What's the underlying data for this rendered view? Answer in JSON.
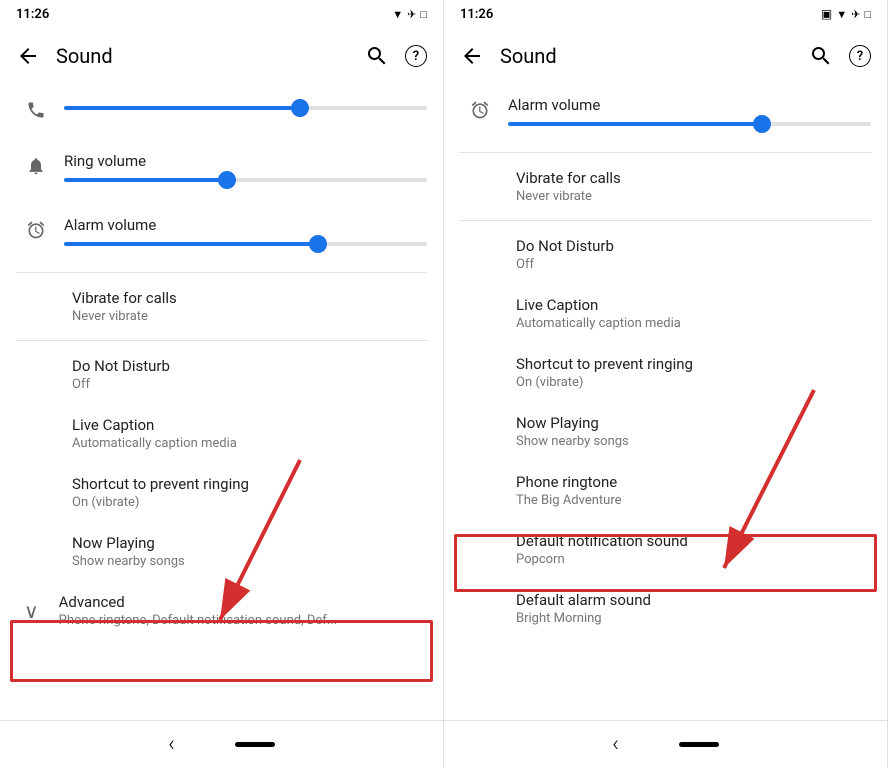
{
  "left_panel": {
    "status": {
      "time": "11:26",
      "icons": "▼ ✈ □"
    },
    "title": "Sound",
    "sliders": [
      {
        "id": "media",
        "fill_pct": 65,
        "thumb_pct": 65
      },
      {
        "id": "ring",
        "label": "Ring volume",
        "fill_pct": 45,
        "thumb_pct": 45
      },
      {
        "id": "alarm",
        "label": "Alarm volume",
        "fill_pct": 70,
        "thumb_pct": 70
      }
    ],
    "settings": [
      {
        "id": "vibrate",
        "title": "Vibrate for calls",
        "subtitle": "Never vibrate"
      },
      {
        "id": "dnd",
        "title": "Do Not Disturb",
        "subtitle": "Off"
      },
      {
        "id": "live_caption",
        "title": "Live Caption",
        "subtitle": "Automatically caption media"
      },
      {
        "id": "prevent_ringing",
        "title": "Shortcut to prevent ringing",
        "subtitle": "On (vibrate)"
      },
      {
        "id": "now_playing",
        "title": "Now Playing",
        "subtitle": "Show nearby songs"
      },
      {
        "id": "advanced",
        "title": "Advanced",
        "subtitle": "Phone ringtone, Default notification sound, Def..."
      }
    ]
  },
  "right_panel": {
    "status": {
      "time": "11:26",
      "icons": "▼ ✈ □"
    },
    "title": "Sound",
    "alarm_volume": {
      "label": "Alarm volume",
      "fill_pct": 70,
      "thumb_pct": 70
    },
    "settings": [
      {
        "id": "vibrate",
        "title": "Vibrate for calls",
        "subtitle": "Never vibrate"
      },
      {
        "id": "dnd",
        "title": "Do Not Disturb",
        "subtitle": "Off"
      },
      {
        "id": "live_caption",
        "title": "Live Caption",
        "subtitle": "Automatically caption media"
      },
      {
        "id": "prevent_ringing",
        "title": "Shortcut to prevent ringing",
        "subtitle": "On (vibrate)"
      },
      {
        "id": "now_playing",
        "title": "Now Playing",
        "subtitle": "Show nearby songs"
      },
      {
        "id": "phone_ringtone",
        "title": "Phone ringtone",
        "subtitle": "The Big Adventure"
      },
      {
        "id": "default_notification",
        "title": "Default notification sound",
        "subtitle": "Popcorn"
      },
      {
        "id": "default_alarm",
        "title": "Default alarm sound",
        "subtitle": "Bright Morning"
      }
    ]
  },
  "icons": {
    "back": "←",
    "search": "🔍",
    "help": "?",
    "phone": "📞",
    "bell": "🔔",
    "alarm": "⏰",
    "chevron_down": "∨",
    "nav_back": "‹",
    "nav_home_pill": "—",
    "wifi": "▼",
    "airplane": "✈",
    "battery": "□",
    "screenshot": "▣"
  }
}
